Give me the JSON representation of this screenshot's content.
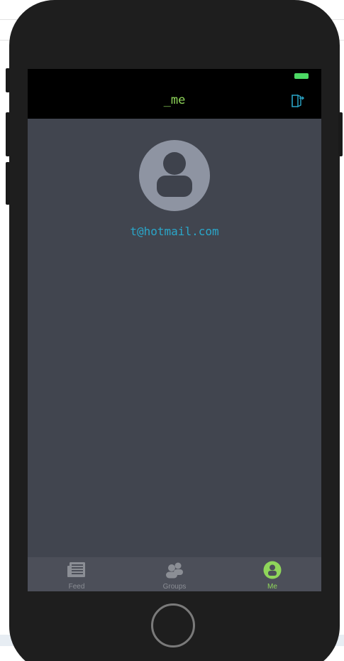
{
  "nav": {
    "title": "_me",
    "logout_icon": "logout-icon"
  },
  "profile": {
    "avatar_icon": "person-icon",
    "email": "t@hotmail.com"
  },
  "tabs": [
    {
      "label": "Feed",
      "icon": "newspaper-icon",
      "active": false
    },
    {
      "label": "Groups",
      "icon": "group-icon",
      "active": false
    },
    {
      "label": "Me",
      "icon": "person-icon",
      "active": true
    }
  ],
  "colors": {
    "accent_green": "#8fd65a",
    "link_blue": "#2aa6c9",
    "screen_bg": "#41454f",
    "tab_bar_bg": "#4c4f59",
    "battery": "#4cd964"
  }
}
